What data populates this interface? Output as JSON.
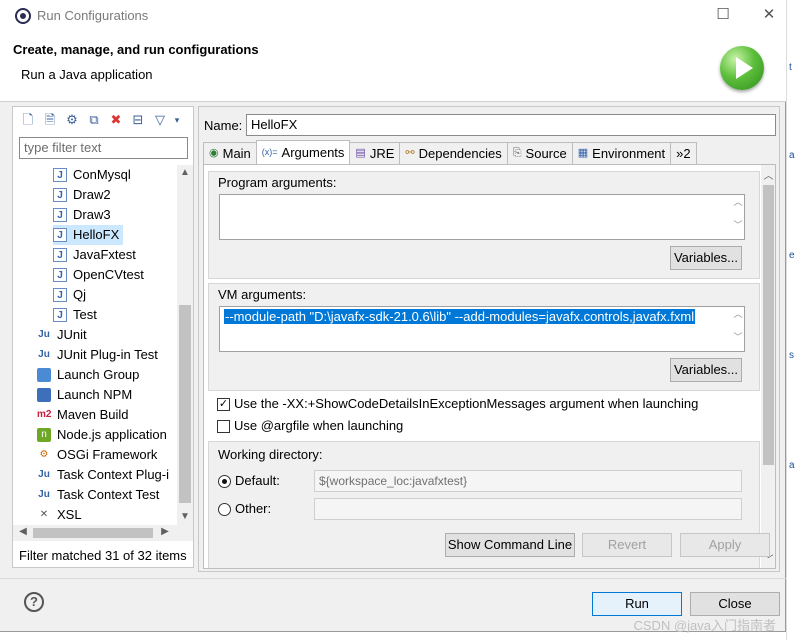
{
  "window": {
    "title": "Run Configurations"
  },
  "header": {
    "title": "Create, manage, and run configurations",
    "subtitle": "Run a Java application"
  },
  "left": {
    "filter_placeholder": "type filter text",
    "items": [
      {
        "label": "ConMysql",
        "icon": "java-app-icon"
      },
      {
        "label": "Draw2",
        "icon": "java-app-icon"
      },
      {
        "label": "Draw3",
        "icon": "java-app-icon"
      },
      {
        "label": "HelloFX",
        "icon": "java-app-icon",
        "selected": true
      },
      {
        "label": "JavaFxtest",
        "icon": "java-app-icon"
      },
      {
        "label": "OpenCVtest",
        "icon": "java-app-icon"
      },
      {
        "label": "Qj",
        "icon": "java-app-icon"
      },
      {
        "label": "Test",
        "icon": "java-app-icon"
      },
      {
        "label": "JUnit",
        "icon": "junit-icon"
      },
      {
        "label": "JUnit Plug-in Test",
        "icon": "junit-plugin-icon"
      },
      {
        "label": "Launch Group",
        "icon": "launch-group-icon"
      },
      {
        "label": "Launch NPM",
        "icon": "npm-icon"
      },
      {
        "label": "Maven Build",
        "icon": "maven-icon"
      },
      {
        "label": "Node.js application",
        "icon": "nodejs-icon"
      },
      {
        "label": "OSGi Framework",
        "icon": "osgi-icon"
      },
      {
        "label": "Task Context Plug-i",
        "icon": "task-context-plugin-icon"
      },
      {
        "label": "Task Context Test",
        "icon": "task-context-test-icon"
      },
      {
        "label": "XSL",
        "icon": "xsl-icon"
      }
    ],
    "status": "Filter matched 31 of 32 items"
  },
  "right": {
    "name_label": "Name:",
    "name_value": "HelloFX",
    "tabs": [
      {
        "label": "Main"
      },
      {
        "label": "Arguments",
        "active": true
      },
      {
        "label": "JRE"
      },
      {
        "label": "Dependencies"
      },
      {
        "label": "Source"
      },
      {
        "label": "Environment"
      },
      {
        "label": "»2"
      }
    ],
    "program_args": {
      "label": "Program arguments:",
      "value": "",
      "variables_button": "Variables..."
    },
    "vm_args": {
      "label": "VM arguments:",
      "value": "--module-path \"D:\\javafx-sdk-21.0.6\\lib\" --add-modules=javafx.controls,javafx.fxml",
      "variables_button": "Variables..."
    },
    "show_code_details": {
      "label": "Use the -XX:+ShowCodeDetailsInExceptionMessages argument when launching",
      "checked": true
    },
    "use_argfile": {
      "label": "Use @argfile when launching",
      "checked": false
    },
    "working_dir": {
      "label": "Working directory:",
      "default_label": "Default:",
      "default_value": "${workspace_loc:javafxtest}",
      "other_label": "Other:",
      "other_value": ""
    }
  },
  "buttons": {
    "show_command_line": "Show Command Line",
    "revert": "Revert",
    "apply": "Apply",
    "run": "Run",
    "close": "Close"
  },
  "watermark": "CSDN @java入门指南者",
  "colors": {
    "selection": "#0078d7",
    "tree_selected": "#cce8ff",
    "run_logo": "#5cbf3a"
  }
}
